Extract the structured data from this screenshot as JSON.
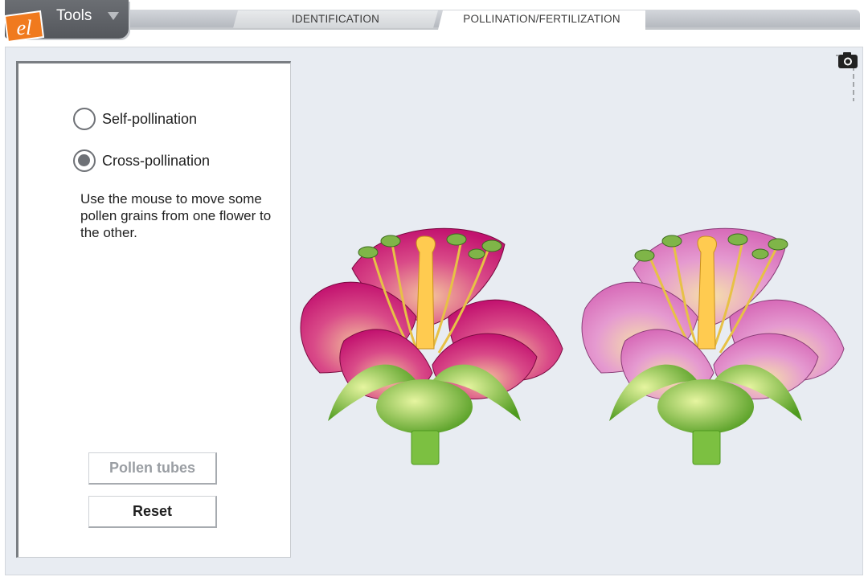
{
  "toolbar": {
    "tools_label": "Tools",
    "logo_text": "el"
  },
  "tabs": [
    {
      "label": "IDENTIFICATION",
      "active": false
    },
    {
      "label": "POLLINATION/FERTILIZATION",
      "active": true
    }
  ],
  "panel": {
    "options": [
      {
        "label": "Self-pollination",
        "checked": false
      },
      {
        "label": "Cross-pollination",
        "checked": true
      }
    ],
    "instructions": "Use the mouse to move some pollen grains from one flower to the other.",
    "buttons": {
      "pollen_tubes": "Pollen tubes",
      "pollen_tubes_enabled": false,
      "reset": "Reset"
    }
  },
  "flowers": [
    {
      "petal_color": "#c2126f",
      "petal_light": "#f4c49c"
    },
    {
      "petal_color": "#d76bb8",
      "petal_light": "#f6e0a9"
    }
  ],
  "colors": {
    "accent_orange": "#f07a1e",
    "toolbar_gray": "#5f6267",
    "stage_bg": "#e8ecf2",
    "pistil_yellow": "#ffcb50",
    "sepal_green": "#6bb834"
  },
  "icons": {
    "camera": "camera-icon",
    "dropdown": "caret-down-icon",
    "logo": "explorelearning-logo"
  }
}
